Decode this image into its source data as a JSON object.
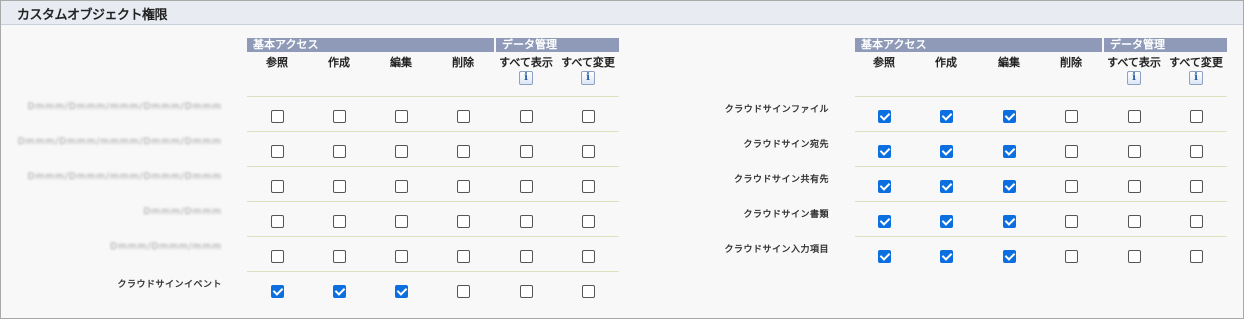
{
  "title": "カスタムオブジェクト権限",
  "groups": {
    "basic": "基本アクセス",
    "data_mgmt": "データ管理"
  },
  "columns": [
    "参照",
    "作成",
    "編集",
    "削除",
    "すべて表示",
    "すべて変更"
  ],
  "info_glyph": "i",
  "accent_color": "#0b6fe0",
  "left_rows": [
    {
      "label": "Dmmm/Dmmm/mmm/Dmmm/Dmmm",
      "redacted": true,
      "values": [
        false,
        false,
        false,
        false,
        false,
        false
      ]
    },
    {
      "label": "Dmmm/Dmmm/mmmm/Dmmm/Dmmm",
      "redacted": true,
      "values": [
        false,
        false,
        false,
        false,
        false,
        false
      ]
    },
    {
      "label": "Dmmm/Dmmm/mmm/Dmmm/Dmmm",
      "redacted": true,
      "values": [
        false,
        false,
        false,
        false,
        false,
        false
      ]
    },
    {
      "label": "Dmmm/Dmmm",
      "redacted": true,
      "values": [
        false,
        false,
        false,
        false,
        false,
        false
      ]
    },
    {
      "label": "Dmmm/Dmmm/mmm",
      "redacted": true,
      "values": [
        false,
        false,
        false,
        false,
        false,
        false
      ]
    },
    {
      "label": "クラウドサインイベント",
      "redacted": false,
      "values": [
        true,
        true,
        true,
        false,
        false,
        false
      ]
    }
  ],
  "right_rows": [
    {
      "label": "クラウドサインファイル",
      "redacted": false,
      "values": [
        true,
        true,
        true,
        false,
        false,
        false
      ]
    },
    {
      "label": "クラウドサイン宛先",
      "redacted": false,
      "values": [
        true,
        true,
        true,
        false,
        false,
        false
      ]
    },
    {
      "label": "クラウドサイン共有先",
      "redacted": false,
      "values": [
        true,
        true,
        true,
        false,
        false,
        false
      ]
    },
    {
      "label": "クラウドサイン書類",
      "redacted": false,
      "values": [
        true,
        true,
        true,
        false,
        false,
        false
      ]
    },
    {
      "label": "クラウドサイン入力項目",
      "redacted": false,
      "values": [
        true,
        true,
        true,
        false,
        false,
        false
      ]
    }
  ]
}
